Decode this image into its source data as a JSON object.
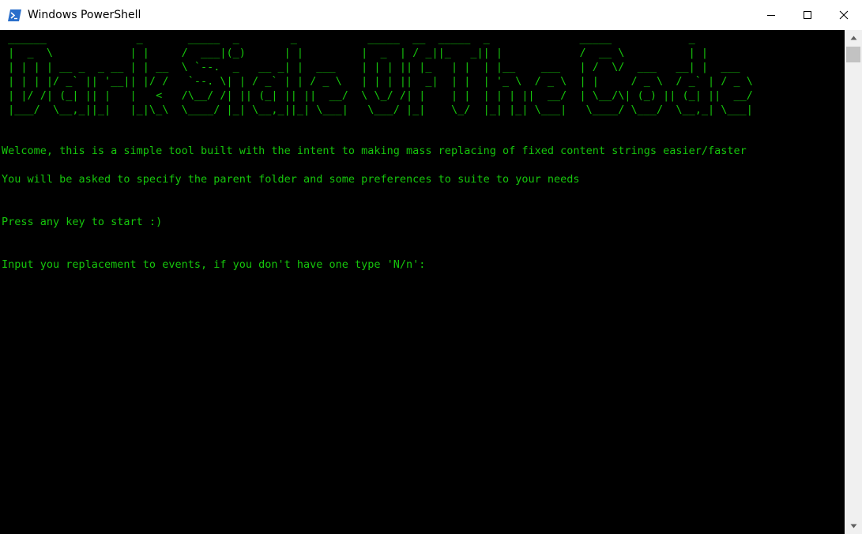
{
  "window": {
    "title": "Windows PowerShell",
    "app_icon": "powershell-icon",
    "controls": [
      "minimize-icon",
      "maximize-icon",
      "close-icon"
    ]
  },
  "console": {
    "text_color": "#16c60c",
    "background": "#000000",
    "banner": [
      " ______              _       _____  _        _           _____  __  _____  _              _____            _ ",
      " |  _  \\            | |     /  ___|(_)      | |         |  _  | / _||_   _|| |            /  __ \\          | |",
      " | | | | __ _  _ __ | | __  \\ `--.  _   __ _| |  ___    | | | || |_   | |  | |__    ___   | /  \\/  ___   __| |  ___ ",
      " | | | |/ _` || '__|| |/ /   `--. \\| | / _` | | / _ \\   | | | ||  _|  | |  | '_ \\  / _ \\  | |     / _ \\  / _` | / _ \\",
      " | |/ /| (_| || |   |   <   /\\__/ /| || (_| || ||  __/  \\ \\_/ /| |    | |  | | | ||  __/  | \\__/\\| (_) || (_| ||  __/",
      " |___/  \\__,_||_|   |_|\\_\\  \\____/ |_| \\__,_||_| \\___|   \\___/ |_|    \\_/  |_| |_| \\___|   \\____/ \\___/  \\__,_| \\___|"
    ],
    "messages": {
      "welcome": "Welcome, this is a simple tool built with the intent to making mass replacing of fixed content strings easier/faster",
      "instructions": "You will be asked to specify the parent folder and some preferences to suite to your needs",
      "press_key": "Press any key to start :)",
      "prompt": "Input you replacement to events, if you don't have one type 'N/n':"
    }
  },
  "scrollbar": {
    "up_arrow": "scroll-up-arrow-icon",
    "down_arrow": "scroll-down-arrow-icon"
  }
}
